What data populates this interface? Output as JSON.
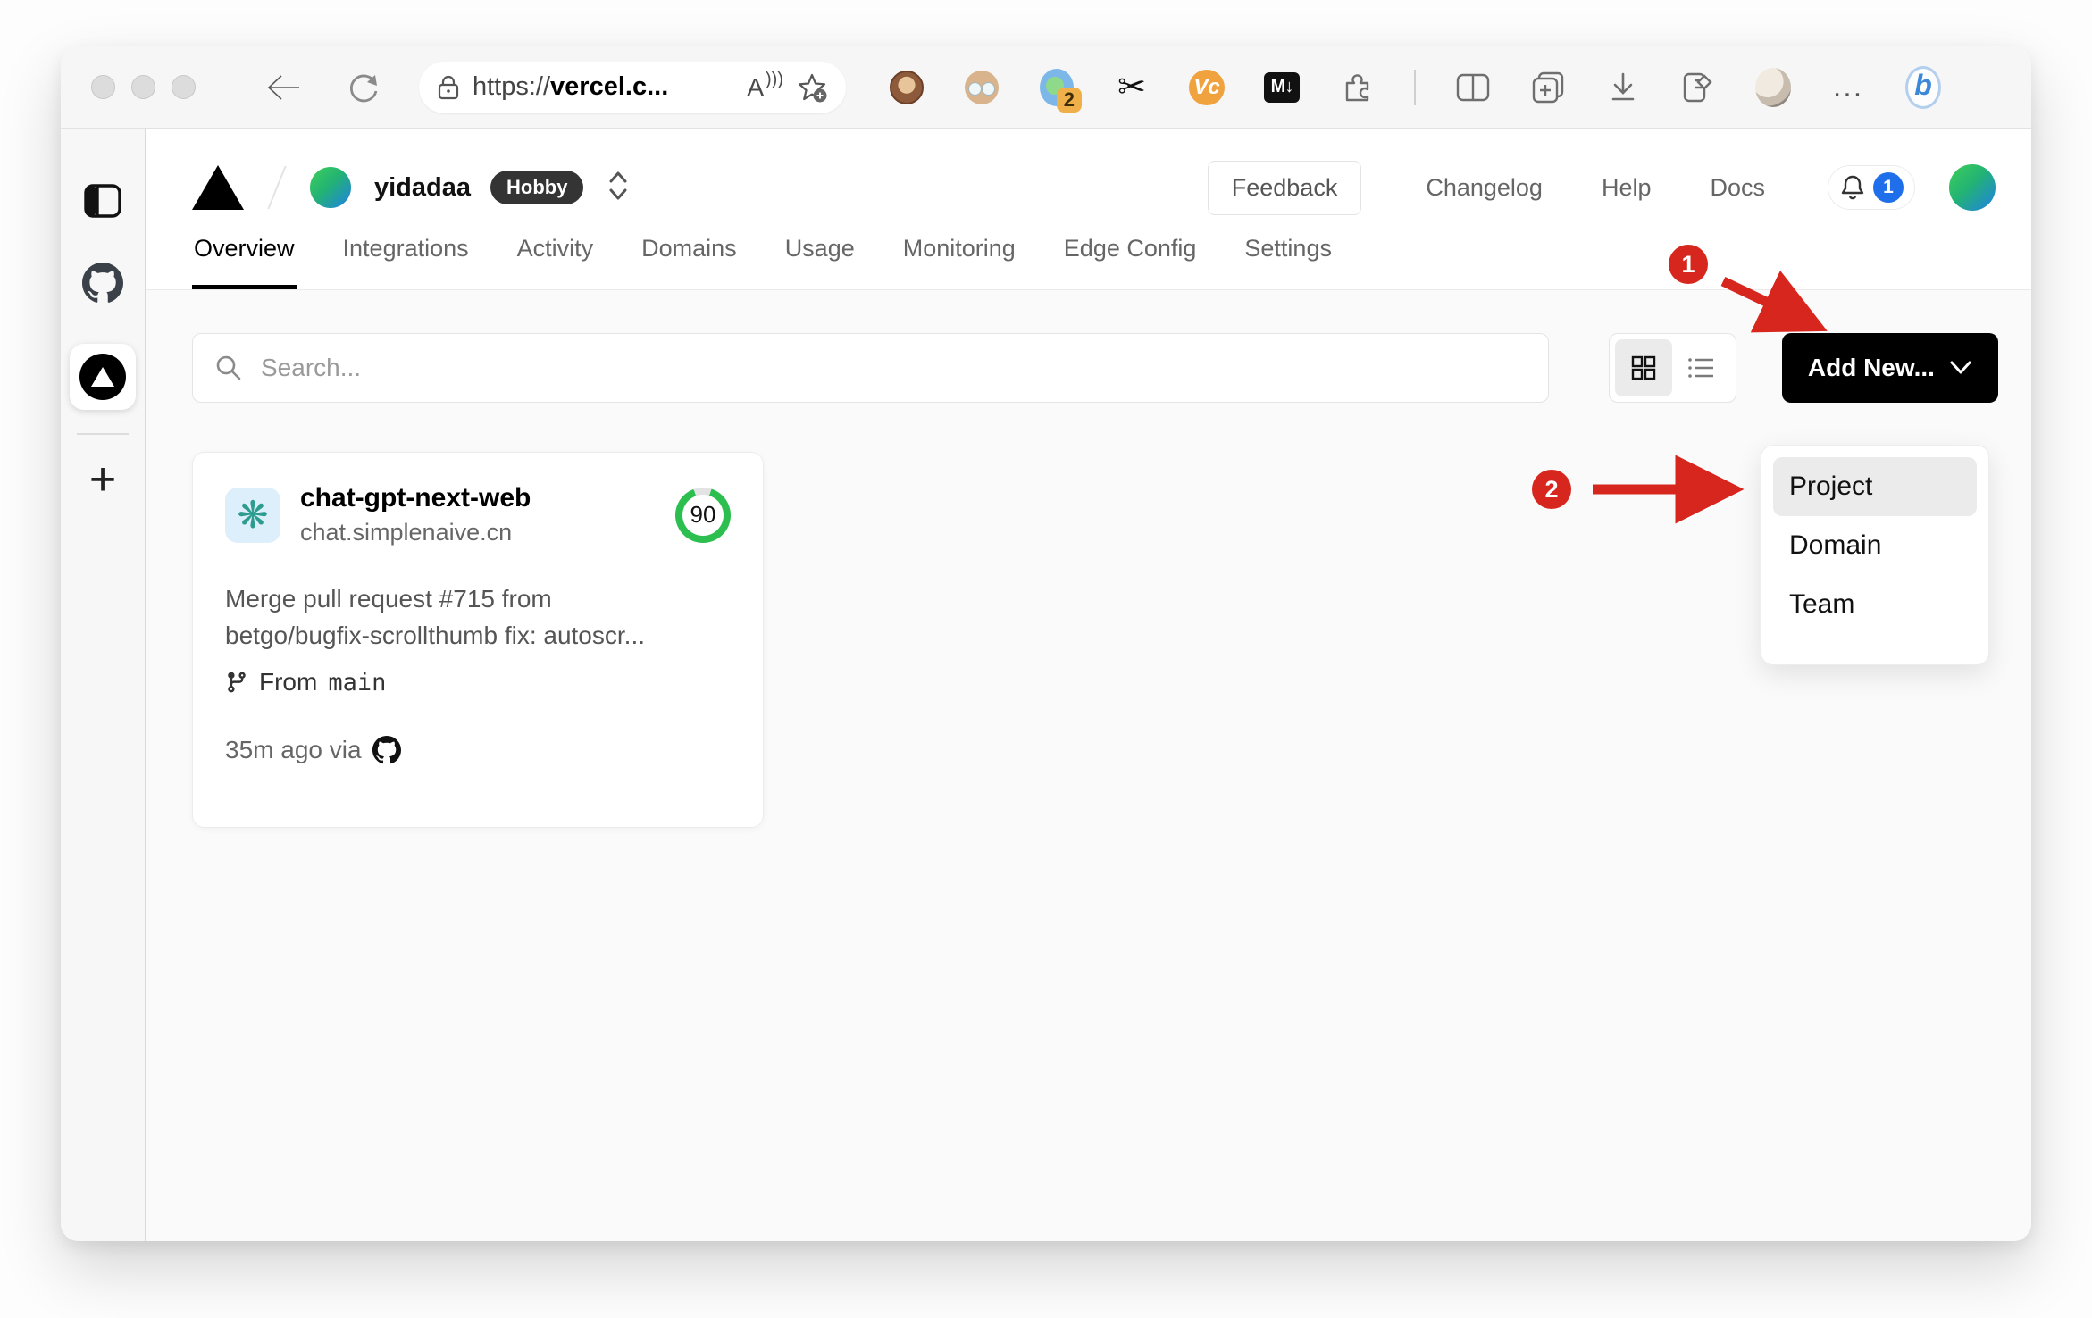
{
  "browser": {
    "back_label": "back",
    "url": {
      "scheme": "https://",
      "host": "vercel.c..."
    },
    "read_aloud_label": "A",
    "extensions": {
      "counter_badge": "2",
      "vc_label": "Vc",
      "markdown_label": "M↓",
      "bing_label": "b",
      "menu_dots": "..."
    }
  },
  "sidebar": {
    "plus_label": "+"
  },
  "header": {
    "team_name": "yidadaa",
    "plan_badge": "Hobby",
    "feedback_label": "Feedback",
    "links": [
      {
        "label": "Changelog"
      },
      {
        "label": "Help"
      },
      {
        "label": "Docs"
      }
    ],
    "notification_count": "1"
  },
  "tabs": [
    {
      "label": "Overview"
    },
    {
      "label": "Integrations"
    },
    {
      "label": "Activity"
    },
    {
      "label": "Domains"
    },
    {
      "label": "Usage"
    },
    {
      "label": "Monitoring"
    },
    {
      "label": "Edge Config"
    },
    {
      "label": "Settings"
    }
  ],
  "toolbar": {
    "search_placeholder": "Search...",
    "add_new_label": "Add New..."
  },
  "dropdown": {
    "items": [
      {
        "label": "Project"
      },
      {
        "label": "Domain"
      },
      {
        "label": "Team"
      }
    ],
    "selected": "Project"
  },
  "project_card": {
    "name": "chat-gpt-next-web",
    "domain": "chat.simplenaive.cn",
    "score": "90",
    "commit_line1": "Merge pull request #715 from",
    "commit_line2": "betgo/bugfix-scrollthumb fix: autoscr...",
    "branch_prefix": "From",
    "branch_name": "main",
    "meta_text": "35m ago via"
  },
  "annotations": {
    "step1": "1",
    "step2": "2"
  },
  "colors": {
    "annotation_red": "#d7261d",
    "score_green": "#2cbe4e",
    "notification_blue": "#1f6feb",
    "accent_black": "#000000",
    "content_bg": "#fafafa"
  }
}
